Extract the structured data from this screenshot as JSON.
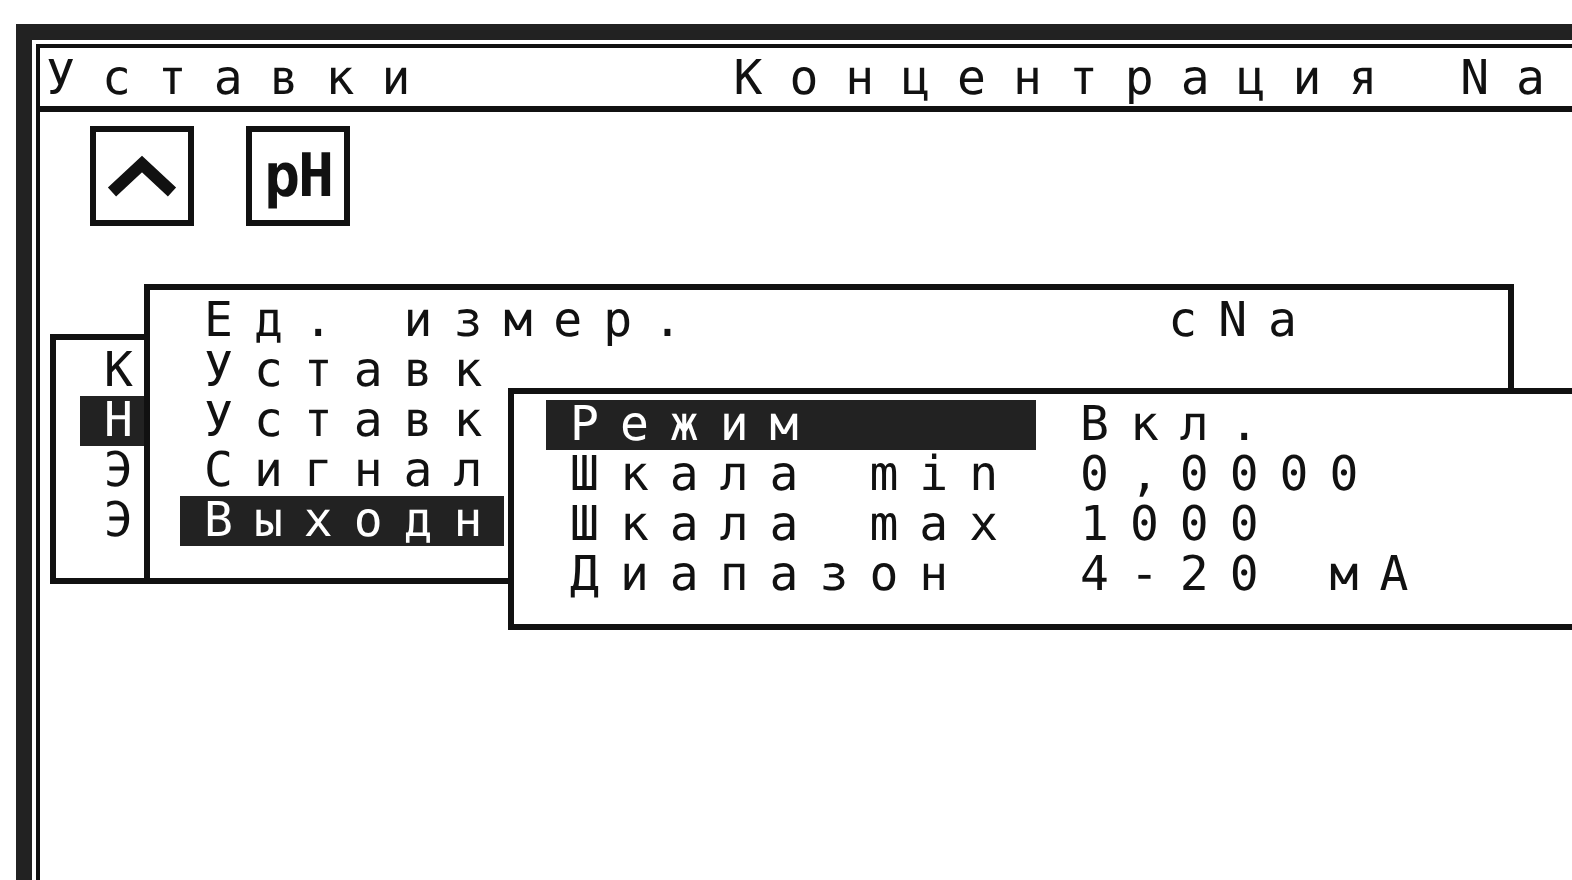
{
  "header": {
    "title": "Уставки",
    "parameter": "Концентрация Na"
  },
  "toolbar": [
    {
      "kind": "chevron"
    },
    {
      "kind": "text",
      "label": "pH"
    }
  ],
  "menus": [
    {
      "items": [
        {
          "label": "К",
          "selected": false
        },
        {
          "label": "Н",
          "selected": true
        },
        {
          "label": "Э",
          "selected": false
        },
        {
          "label": "Э",
          "selected": false
        }
      ]
    },
    {
      "items": [
        {
          "label": "Ед. измер.",
          "value": "cNa",
          "selected": false
        },
        {
          "label": "Уставк",
          "selected": false
        },
        {
          "label": "Уставк",
          "selected": false
        },
        {
          "label": "Сигнал",
          "selected": false
        },
        {
          "label": "Выходн",
          "selected": true
        }
      ]
    },
    {
      "items": [
        {
          "label": "Режим",
          "value": "Вкл.",
          "selected": true
        },
        {
          "label": "Шкала min",
          "value": "0,0000",
          "selected": false
        },
        {
          "label": "Шкала max",
          "value": "1000",
          "selected": false
        },
        {
          "label": "Диапазон",
          "value": "4-20 мА",
          "selected": false
        }
      ]
    }
  ]
}
